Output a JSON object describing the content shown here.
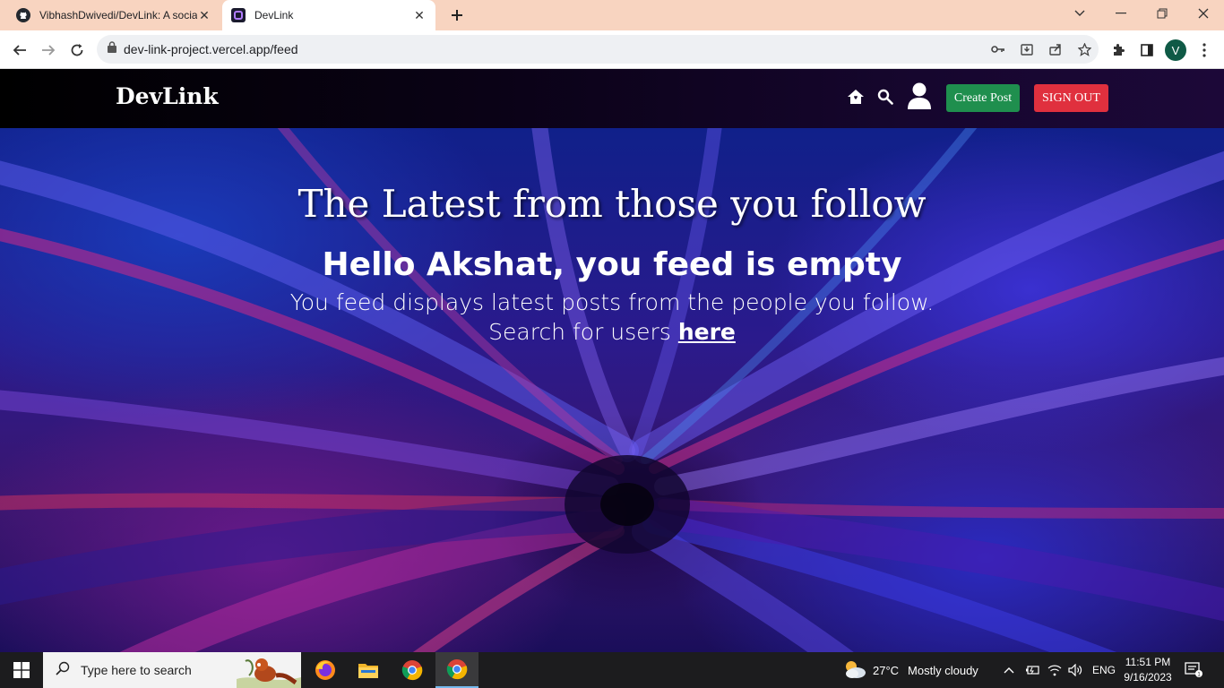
{
  "browser": {
    "tabs": [
      {
        "title": "VibhashDwivedi/DevLink: A socia",
        "icon": "github-icon",
        "active": false
      },
      {
        "title": "DevLink",
        "icon": "devlink-favicon",
        "active": true
      }
    ],
    "address": "dev-link-project.vercel.app/feed",
    "profile_initial": "V"
  },
  "navbar": {
    "brand": "DevLink",
    "create_post_label": "Create Post",
    "sign_out_label": "SIGN OUT",
    "icons": [
      "home-icon",
      "search-icon",
      "user-icon"
    ],
    "create_post_color": "#1f8f4e",
    "sign_out_color": "#e0303e"
  },
  "hero": {
    "title": "The Latest from those you follow",
    "heading": "Hello Akshat, you feed is empty",
    "desc_line1": "You feed displays latest posts from the people you follow.",
    "desc_line2": "Search for users",
    "link_text": "here"
  },
  "taskbar": {
    "search_placeholder": "Type here to search",
    "weather_temp": "27°C",
    "weather_text": "Mostly cloudy",
    "language": "ENG",
    "time": "11:51 PM",
    "date": "9/16/2023",
    "apps": [
      "firefox-icon",
      "file-explorer-icon",
      "chrome-icon",
      "chrome-icon"
    ]
  }
}
